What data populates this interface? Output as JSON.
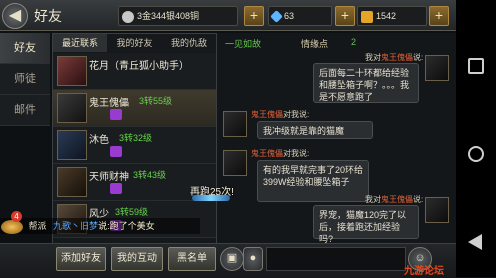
{
  "header": {
    "title": "好友",
    "back_glyph": "◀",
    "silver": "3金344银408铜",
    "diamond": "63",
    "gold": "1542",
    "colors": {
      "silver_icon": "#c8c8c8",
      "diamond_icon": "#5fb6ff",
      "gold_icon": "#e2a52a"
    }
  },
  "left_tabs": [
    {
      "label": "好友",
      "active": true
    },
    {
      "label": "师徒",
      "active": false
    },
    {
      "label": "邮件",
      "active": false
    }
  ],
  "list_tabs": [
    {
      "label": "最近联系",
      "active": true
    },
    {
      "label": "我的好友",
      "active": false
    },
    {
      "label": "我的仇敌",
      "active": false
    }
  ],
  "friends": [
    {
      "name": "花月（青丘狐小助手）",
      "level": "",
      "heart": false,
      "selected": false
    },
    {
      "name": "鬼王傀儡",
      "level": "3转55级",
      "heart": true,
      "selected": true
    },
    {
      "name": "沐色",
      "level": "3转32级",
      "heart": true,
      "selected": false
    },
    {
      "name": "天师财神",
      "level": "3转43级",
      "heart": true,
      "selected": false
    },
    {
      "name": "风少",
      "level": "3转59级",
      "heart": true,
      "selected": false
    }
  ],
  "chat": {
    "header_left": "一见如故",
    "header_mid": "情缘点",
    "header_value": "2",
    "messages": [
      {
        "side": "right",
        "speaker_prefix": "我对",
        "speaker_name": "鬼王傀儡",
        "speaker_suffix": "说:",
        "text": "后面每二十环都给经验和腰坠箱子啊？。。。我是不愿意跑了"
      },
      {
        "side": "left",
        "speaker_prefix": "",
        "speaker_name": "鬼王傀儡",
        "speaker_suffix": "对我说:",
        "text": "我冲级就是靠的猫魔"
      },
      {
        "side": "left",
        "speaker_prefix": "",
        "speaker_name": "鬼王傀儡",
        "speaker_suffix": "对我说:",
        "text": "有的我早就完事了20环给399W经验和腰坠箱子"
      },
      {
        "side": "right",
        "speaker_prefix": "我对",
        "speaker_name": "鬼王傀儡",
        "speaker_suffix": "说:",
        "text": "界宠，猫魔120完了以后，接着跑还加经验吗?"
      }
    ]
  },
  "overlay": {
    "rerun_text": "再跑25次!",
    "ticker_label": "帮派",
    "ticker_name": "九歌丶旧梦",
    "ticker_text": "说:跑了个美女",
    "ticker_badge": "4"
  },
  "bottom": {
    "add_friend": "添加好友",
    "my_interaction": "我的互动",
    "blacklist": "黑名单",
    "watermark": "九游论坛"
  }
}
